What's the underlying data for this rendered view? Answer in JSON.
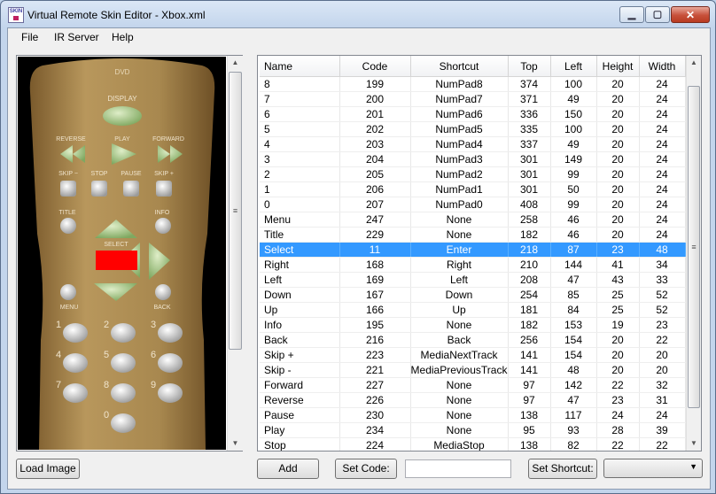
{
  "window": {
    "title": "Virtual Remote Skin Editor - Xbox.xml",
    "icon_text": "SKIN",
    "controls": {
      "minimize": "▁",
      "maximize": "▢",
      "close": "✕"
    }
  },
  "menu": [
    "File",
    "IR Server",
    "Help"
  ],
  "remote": {
    "labels": {
      "brand": "DVD",
      "display": "DISPLAY",
      "reverse": "REVERSE",
      "play": "PLAY",
      "forward": "FORWARD",
      "skip_minus": "SKIP −",
      "stop": "STOP",
      "pause": "PAUSE",
      "skip_plus": "SKIP +",
      "title": "TITLE",
      "info": "INFO",
      "select": "SELECT",
      "menu": "MENU",
      "back": "BACK"
    },
    "digits": [
      "1",
      "2",
      "3",
      "4",
      "5",
      "6",
      "7",
      "8",
      "9",
      "0"
    ],
    "select_highlight_color": "#ff0000"
  },
  "grid": {
    "columns": [
      "Name",
      "Code",
      "Shortcut",
      "Top",
      "Left",
      "Height",
      "Width"
    ],
    "rows": [
      [
        "8",
        "199",
        "NumPad8",
        "374",
        "100",
        "20",
        "24"
      ],
      [
        "7",
        "200",
        "NumPad7",
        "371",
        "49",
        "20",
        "24"
      ],
      [
        "6",
        "201",
        "NumPad6",
        "336",
        "150",
        "20",
        "24"
      ],
      [
        "5",
        "202",
        "NumPad5",
        "335",
        "100",
        "20",
        "24"
      ],
      [
        "4",
        "203",
        "NumPad4",
        "337",
        "49",
        "20",
        "24"
      ],
      [
        "3",
        "204",
        "NumPad3",
        "301",
        "149",
        "20",
        "24"
      ],
      [
        "2",
        "205",
        "NumPad2",
        "301",
        "99",
        "20",
        "24"
      ],
      [
        "1",
        "206",
        "NumPad1",
        "301",
        "50",
        "20",
        "24"
      ],
      [
        "0",
        "207",
        "NumPad0",
        "408",
        "99",
        "20",
        "24"
      ],
      [
        "Menu",
        "247",
        "None",
        "258",
        "46",
        "20",
        "24"
      ],
      [
        "Title",
        "229",
        "None",
        "182",
        "46",
        "20",
        "24"
      ],
      [
        "Select",
        "11",
        "Enter",
        "218",
        "87",
        "23",
        "48"
      ],
      [
        "Right",
        "168",
        "Right",
        "210",
        "144",
        "41",
        "34"
      ],
      [
        "Left",
        "169",
        "Left",
        "208",
        "47",
        "43",
        "33"
      ],
      [
        "Down",
        "167",
        "Down",
        "254",
        "85",
        "25",
        "52"
      ],
      [
        "Up",
        "166",
        "Up",
        "181",
        "84",
        "25",
        "52"
      ],
      [
        "Info",
        "195",
        "None",
        "182",
        "153",
        "19",
        "23"
      ],
      [
        "Back",
        "216",
        "Back",
        "256",
        "154",
        "20",
        "22"
      ],
      [
        "Skip +",
        "223",
        "MediaNextTrack",
        "141",
        "154",
        "20",
        "20"
      ],
      [
        "Skip -",
        "221",
        "MediaPreviousTrack",
        "141",
        "48",
        "20",
        "20"
      ],
      [
        "Forward",
        "227",
        "None",
        "97",
        "142",
        "22",
        "32"
      ],
      [
        "Reverse",
        "226",
        "None",
        "97",
        "47",
        "23",
        "31"
      ],
      [
        "Pause",
        "230",
        "None",
        "138",
        "117",
        "24",
        "24"
      ],
      [
        "Play",
        "234",
        "None",
        "95",
        "93",
        "28",
        "39"
      ],
      [
        "Stop",
        "224",
        "MediaStop",
        "138",
        "82",
        "22",
        "22"
      ]
    ],
    "selected_row_index": 11
  },
  "buttons": {
    "load_image": "Load Image",
    "add": "Add",
    "set_code": "Set Code:",
    "set_shortcut": "Set Shortcut:"
  },
  "inputs": {
    "code_value": "",
    "shortcut_value": ""
  },
  "colors": {
    "selection": "#3399ff",
    "remote_body": "#a5864d"
  }
}
